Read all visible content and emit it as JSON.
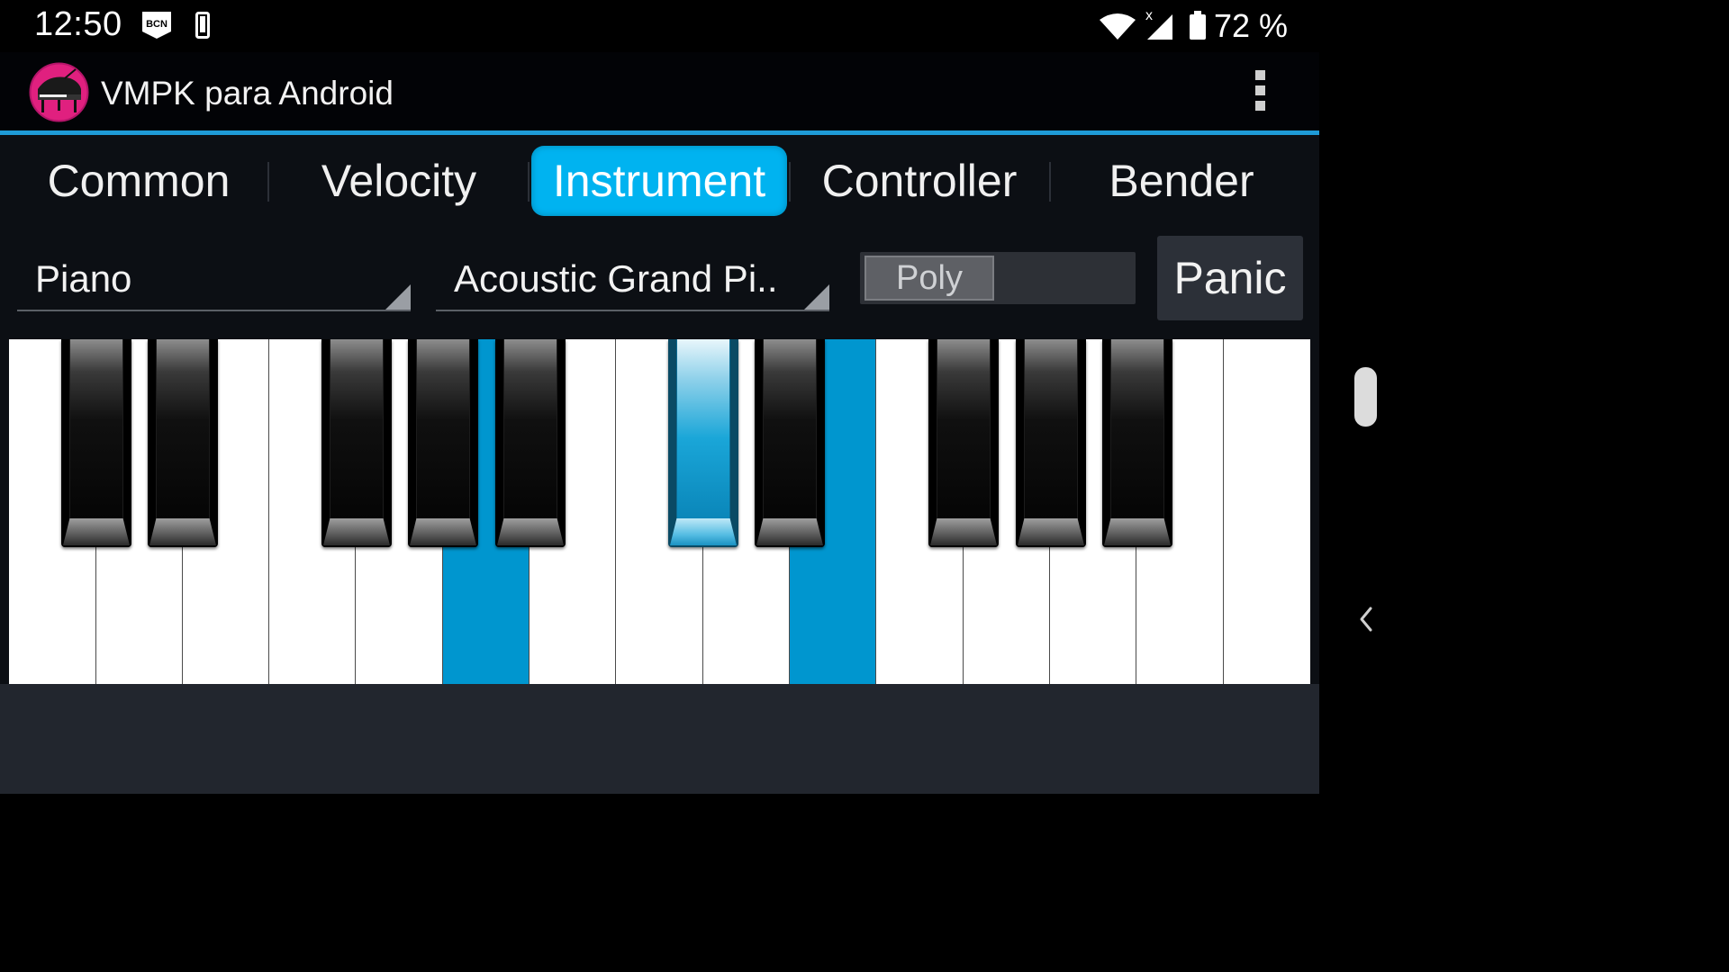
{
  "status_bar": {
    "time": "12:50",
    "badge": "BCN",
    "battery_percent": "72 %",
    "icons": [
      "bcn-badge-icon",
      "phone-icon",
      "wifi-icon",
      "cell-signal-icon",
      "battery-icon"
    ]
  },
  "app": {
    "title": "VMPK para Android",
    "icon": "grand-piano-app-icon",
    "menu_icon": "overflow-menu-icon"
  },
  "tabs": [
    {
      "label": "Common",
      "active": false
    },
    {
      "label": "Velocity",
      "active": false
    },
    {
      "label": "Instrument",
      "active": true
    },
    {
      "label": "Controller",
      "active": false
    },
    {
      "label": "Bender",
      "active": false
    }
  ],
  "controls": {
    "bank_spinner": "Piano",
    "program_spinner": "Acoustic Grand Pi..",
    "mode_toggle": "Poly",
    "panic_label": "Panic"
  },
  "keyboard": {
    "white_keys": 15,
    "pressed_white_keys": [
      5,
      9
    ],
    "pressed_black_keys": [
      5
    ],
    "accent_color": "#0096cf"
  },
  "colors": {
    "accent": "#00b3f0",
    "action_bar_line": "#1e9bd7",
    "background": "#0c0f14"
  }
}
